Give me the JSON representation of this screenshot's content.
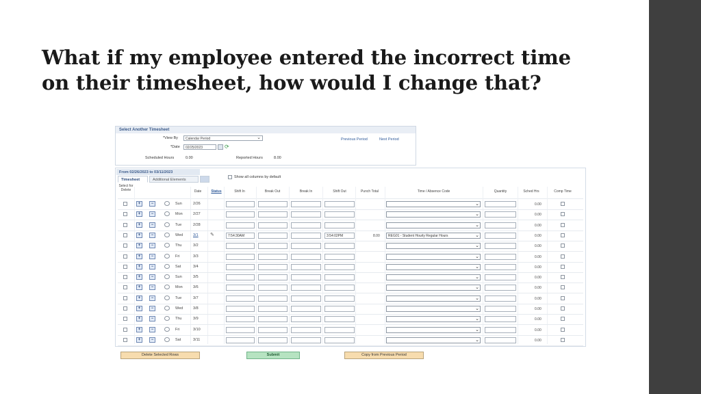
{
  "slide": {
    "title_line1": "What if my employee entered the incorrect time",
    "title_line2": "on their timesheet, how would I change that?"
  },
  "select_panel": {
    "header": "Select Another Timesheet",
    "view_by_label": "*View By",
    "view_by_value": "Calendar Period",
    "date_label": "*Date",
    "date_value": "02/25/2023",
    "scheduled_hours_label": "Scheduled Hours",
    "scheduled_hours_value": "0.00",
    "reported_hours_label": "Reported Hours",
    "reported_hours_value": "8.00",
    "previous_period": "Previous Period",
    "next_period": "Next Period"
  },
  "grid": {
    "range_label": "From 02/26/2023 to 03/11/2023",
    "tabs": [
      "Timesheet",
      "Additional Elements"
    ],
    "show_all_columns": "Show all columns by default",
    "headers": {
      "select": "Select for Delete",
      "date": "Date",
      "status": "Status",
      "shift_in": "Shift In",
      "break_out": "Break Out",
      "break_in": "Break In",
      "shift_out": "Shift Out",
      "punch_total": "Punch Total",
      "trc": "Time / Absence Code",
      "quantity": "Quantity",
      "sched_hrs": "Sched Hrs",
      "comp_time": "Comp Time"
    },
    "rows": [
      {
        "day": "Sun",
        "date": "2/26",
        "shift_in": "",
        "shift_out": "",
        "punch_total": "",
        "trc": "",
        "sched": "0.00"
      },
      {
        "day": "Mon",
        "date": "2/27",
        "shift_in": "",
        "shift_out": "",
        "punch_total": "",
        "trc": "",
        "sched": "0.00"
      },
      {
        "day": "Tue",
        "date": "2/28",
        "shift_in": "",
        "shift_out": "",
        "punch_total": "",
        "trc": "",
        "sched": "0.00"
      },
      {
        "day": "Wed",
        "date": "3/1",
        "shift_in": "7:54:30AM",
        "shift_out": "3:54:02PM",
        "punch_total": "8.00",
        "trc": "REG01 - Student Hourly Regular Hours",
        "sched": "0.00"
      },
      {
        "day": "Thu",
        "date": "3/2",
        "shift_in": "",
        "shift_out": "",
        "punch_total": "",
        "trc": "",
        "sched": "0.00"
      },
      {
        "day": "Fri",
        "date": "3/3",
        "shift_in": "",
        "shift_out": "",
        "punch_total": "",
        "trc": "",
        "sched": "0.00"
      },
      {
        "day": "Sat",
        "date": "3/4",
        "shift_in": "",
        "shift_out": "",
        "punch_total": "",
        "trc": "",
        "sched": "0.00"
      },
      {
        "day": "Sun",
        "date": "3/5",
        "shift_in": "",
        "shift_out": "",
        "punch_total": "",
        "trc": "",
        "sched": "0.00"
      },
      {
        "day": "Mon",
        "date": "3/6",
        "shift_in": "",
        "shift_out": "",
        "punch_total": "",
        "trc": "",
        "sched": "0.00"
      },
      {
        "day": "Tue",
        "date": "3/7",
        "shift_in": "",
        "shift_out": "",
        "punch_total": "",
        "trc": "",
        "sched": "0.00"
      },
      {
        "day": "Wed",
        "date": "3/8",
        "shift_in": "",
        "shift_out": "",
        "punch_total": "",
        "trc": "",
        "sched": "0.00"
      },
      {
        "day": "Thu",
        "date": "3/9",
        "shift_in": "",
        "shift_out": "",
        "punch_total": "",
        "trc": "",
        "sched": "0.00"
      },
      {
        "day": "Fri",
        "date": "3/10",
        "shift_in": "",
        "shift_out": "",
        "punch_total": "",
        "trc": "",
        "sched": "0.00"
      },
      {
        "day": "Sat",
        "date": "3/11",
        "shift_in": "",
        "shift_out": "",
        "punch_total": "",
        "trc": "",
        "sched": "0.00"
      }
    ]
  },
  "buttons": {
    "delete_rows": "Delete Selected Rows",
    "submit": "Submit",
    "copy_previous": "Copy from Previous Period"
  },
  "icons": {
    "add_row": "+",
    "remove_row": "−",
    "chevron": "⌄",
    "pencil": "✎"
  }
}
